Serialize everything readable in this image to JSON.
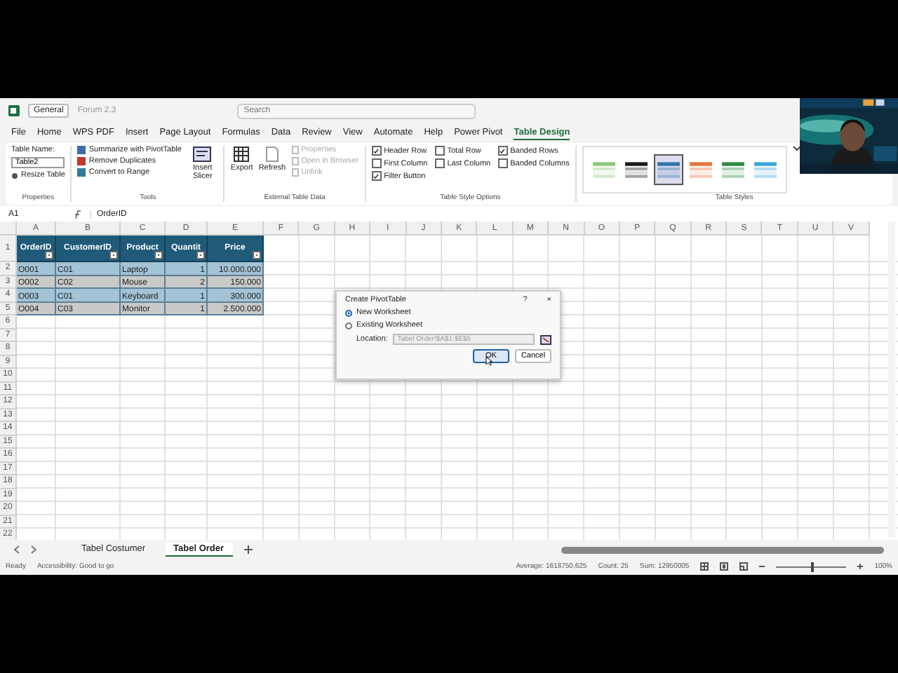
{
  "title_bar": {
    "number_format": "General",
    "file_name": "Forum 2.3",
    "search_placeholder": "Search"
  },
  "menu_tabs": [
    {
      "label": "File",
      "selected": false
    },
    {
      "label": "Home",
      "selected": false
    },
    {
      "label": "WPS PDF",
      "selected": false
    },
    {
      "label": "Insert",
      "selected": false
    },
    {
      "label": "Page Layout",
      "selected": false
    },
    {
      "label": "Formulas",
      "selected": false
    },
    {
      "label": "Data",
      "selected": false
    },
    {
      "label": "Review",
      "selected": false
    },
    {
      "label": "View",
      "selected": false
    },
    {
      "label": "Automate",
      "selected": false
    },
    {
      "label": "Help",
      "selected": false
    },
    {
      "label": "Power Pivot",
      "selected": false
    },
    {
      "label": "Table Design",
      "selected": true
    }
  ],
  "ribbon": {
    "properties": {
      "table_name_label": "Table Name:",
      "table_name": "Table2",
      "resize": "Resize Table",
      "group": "Properties"
    },
    "tools": {
      "items": [
        "Summarize with PivotTable",
        "Remove Duplicates",
        "Convert to Range"
      ],
      "slicer": "Insert Slicer",
      "group": "Tools"
    },
    "external": {
      "export": "Export",
      "refresh": "Refresh",
      "items": [
        {
          "label": "Properties",
          "disabled": true
        },
        {
          "label": "Open in Browser",
          "disabled": true
        },
        {
          "label": "Unlink",
          "disabled": true
        }
      ],
      "group": "External Table Data"
    },
    "style_options": {
      "options": [
        {
          "label": "Header Row",
          "checked": true
        },
        {
          "label": "Total Row",
          "checked": false
        },
        {
          "label": "Banded Rows",
          "checked": true
        },
        {
          "label": "First Column",
          "checked": false
        },
        {
          "label": "Last Column",
          "checked": false
        },
        {
          "label": "Banded Columns",
          "checked": false
        },
        {
          "label": "Filter Button",
          "checked": true
        }
      ],
      "group": "Table Style Options"
    },
    "styles": {
      "swatches": [
        {
          "color": "#8cc97a",
          "selected": false
        },
        {
          "color": "#1a1a1a",
          "selected": false
        },
        {
          "color": "#2f75a8",
          "selected": true
        },
        {
          "color": "#e8743b",
          "selected": false
        },
        {
          "color": "#2e8b3e",
          "selected": false
        },
        {
          "color": "#3aa6dc",
          "selected": false
        }
      ],
      "group": "Table Styles"
    }
  },
  "formula_bar": {
    "name_box": "A1",
    "formula": "OrderID"
  },
  "sheet": {
    "columns": [
      "A",
      "B",
      "C",
      "D",
      "E",
      "F",
      "G",
      "H",
      "I",
      "J",
      "K",
      "L",
      "M",
      "N",
      "O",
      "P",
      "Q",
      "R",
      "S",
      "T",
      "U",
      "V"
    ],
    "rows": [
      "1",
      "2",
      "3",
      "4",
      "5",
      "6",
      "7",
      "8",
      "9",
      "10",
      "11",
      "12",
      "13",
      "14",
      "15",
      "16",
      "17",
      "18",
      "19",
      "20",
      "21",
      "22"
    ],
    "table": {
      "columns": [
        {
          "header": "OrderID",
          "numeric": false
        },
        {
          "header": "CustomerID",
          "numeric": false
        },
        {
          "header": "Product",
          "numeric": false
        },
        {
          "header": "Quantit",
          "numeric": true
        },
        {
          "header": "Price",
          "numeric": true
        }
      ],
      "rows": [
        [
          "O001",
          "C01",
          "Laptop",
          "1",
          "10.000.000"
        ],
        [
          "O002",
          "C02",
          "Mouse",
          "2",
          "150.000"
        ],
        [
          "O003",
          "C01",
          "Keyboard",
          "1",
          "300.000"
        ],
        [
          "O004",
          "C03",
          "Monitor",
          "1",
          "2.500.000"
        ]
      ]
    }
  },
  "dialog": {
    "title": "Create PivotTable",
    "help": "?",
    "close": "×",
    "options": [
      {
        "label": "New Worksheet",
        "selected": true
      },
      {
        "label": "Existing Worksheet",
        "selected": false
      }
    ],
    "location_label": "Location:",
    "location": "Tabel Order!$A$1:$E$5",
    "location_disabled": true,
    "ok": "OK",
    "cancel": "Cancel"
  },
  "sheet_tabs": [
    {
      "label": "Tabel Costumer",
      "selected": false
    },
    {
      "label": "Tabel Order",
      "selected": true
    }
  ],
  "status_bar": {
    "mode": "Ready",
    "accessibility": "Accessibility: Good to go",
    "average": "Average: 1618750,625",
    "count": "Count: 25",
    "sum": "Sum: 12950005",
    "zoom": "100%",
    "level": 0.5
  }
}
